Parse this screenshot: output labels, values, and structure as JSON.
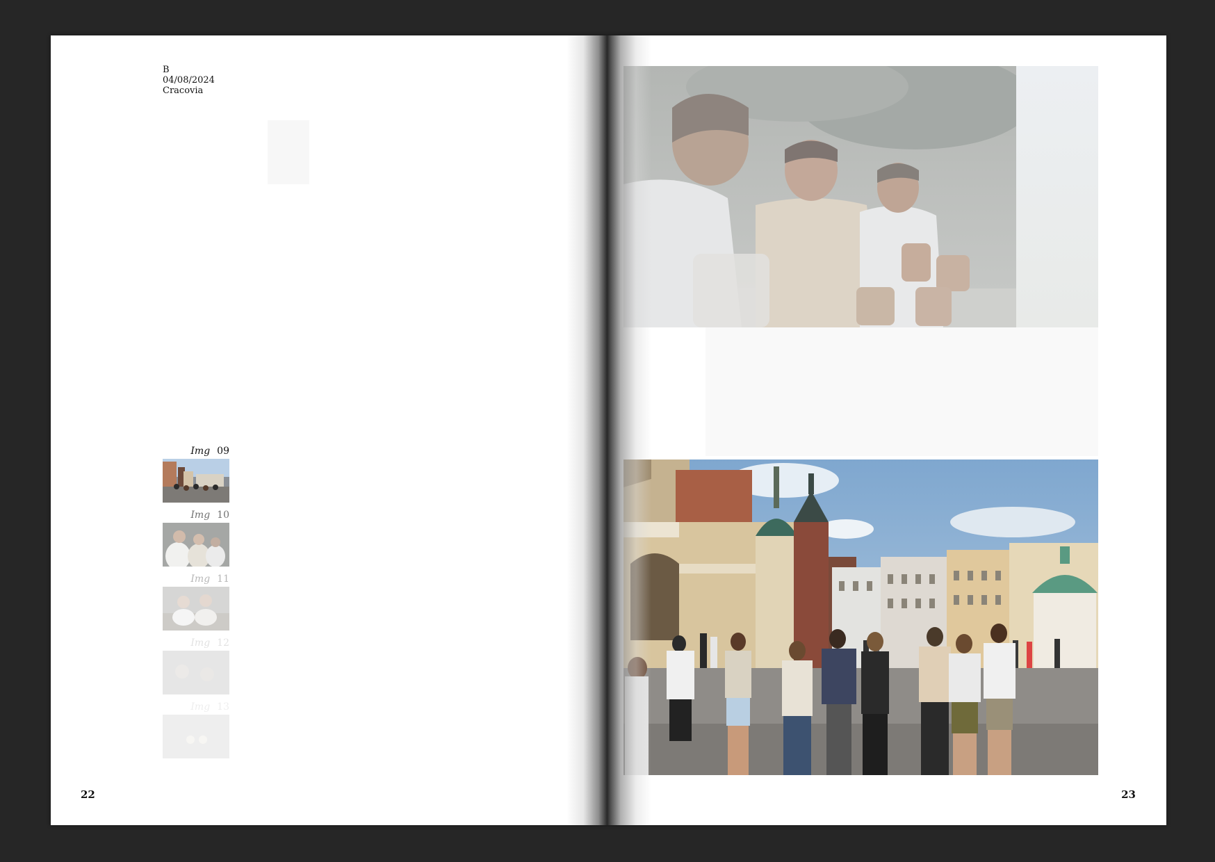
{
  "left_page": {
    "meta": {
      "code": "B",
      "date": "04/08/2024",
      "place": "Cracovia"
    },
    "thumbnails": [
      {
        "prefix": "Img",
        "number": "09",
        "opacity": 1.0
      },
      {
        "prefix": "Img",
        "number": "10",
        "opacity": 0.6
      },
      {
        "prefix": "Img",
        "number": "11",
        "opacity": 0.3
      },
      {
        "prefix": "Img",
        "number": "12",
        "opacity": 0.12
      },
      {
        "prefix": "Img",
        "number": "13",
        "opacity": 0.07
      }
    ],
    "page_number": "22"
  },
  "right_page": {
    "page_number": "23"
  }
}
